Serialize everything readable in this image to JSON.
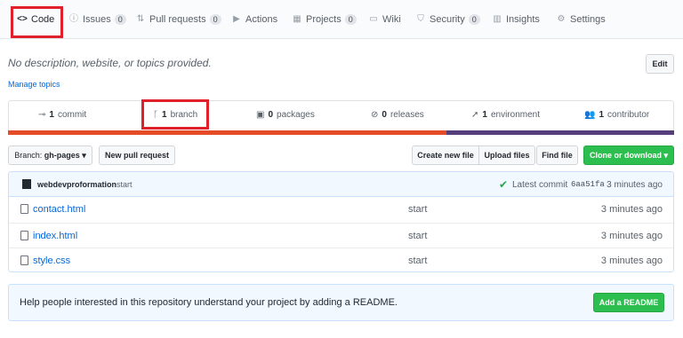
{
  "tabs": [
    {
      "label": "Code",
      "icon": "code-icon",
      "glyph": "<>",
      "active": true
    },
    {
      "label": "Issues",
      "icon": "issue-icon",
      "glyph": "ⓘ",
      "count": "0"
    },
    {
      "label": "Pull requests",
      "icon": "pull-request-icon",
      "glyph": "⇅",
      "count": "0"
    },
    {
      "label": "Actions",
      "icon": "play-icon",
      "glyph": "▶"
    },
    {
      "label": "Projects",
      "icon": "project-icon",
      "glyph": "▦",
      "count": "0"
    },
    {
      "label": "Wiki",
      "icon": "book-icon",
      "glyph": "▭"
    },
    {
      "label": "Security",
      "icon": "shield-icon",
      "glyph": "⛉",
      "count": "0"
    },
    {
      "label": "Insights",
      "icon": "graph-icon",
      "glyph": "▥"
    },
    {
      "label": "Settings",
      "icon": "gear-icon",
      "glyph": "⚙"
    }
  ],
  "repo": {
    "description": "No description, website, or topics provided.",
    "manage_topics": "Manage topics",
    "edit_label": "Edit"
  },
  "summary": {
    "commits": {
      "count": "1",
      "label": "commit"
    },
    "branches": {
      "count": "1",
      "label": "branch"
    },
    "packages": {
      "count": "0",
      "label": "packages"
    },
    "releases": {
      "count": "0",
      "label": "releases"
    },
    "environments": {
      "count": "1",
      "label": "environment"
    },
    "contributors": {
      "count": "1",
      "label": "contributor"
    }
  },
  "language_colors": [
    "#e34c26",
    "#563d7c"
  ],
  "controls": {
    "branch_label": "Branch:",
    "branch_value": "gh-pages",
    "new_pr": "New pull request",
    "create_file": "Create new file",
    "upload_files": "Upload files",
    "find_file": "Find file",
    "clone": "Clone or download"
  },
  "latest_commit": {
    "author": "webdevproformation",
    "message": "start",
    "prefix": "Latest commit",
    "sha": "6aa51fa",
    "age": "3 minutes ago"
  },
  "files": [
    {
      "name": "contact.html",
      "message": "start",
      "age": "3 minutes ago"
    },
    {
      "name": "index.html",
      "message": "start",
      "age": "3 minutes ago"
    },
    {
      "name": "style.css",
      "message": "start",
      "age": "3 minutes ago"
    }
  ],
  "readme": {
    "text": "Help people interested in this repository understand your project by adding a README.",
    "button": "Add a README"
  },
  "colors": {
    "highlight": "#e0202a",
    "link": "#0366d6",
    "green": "#2cbe4e"
  }
}
